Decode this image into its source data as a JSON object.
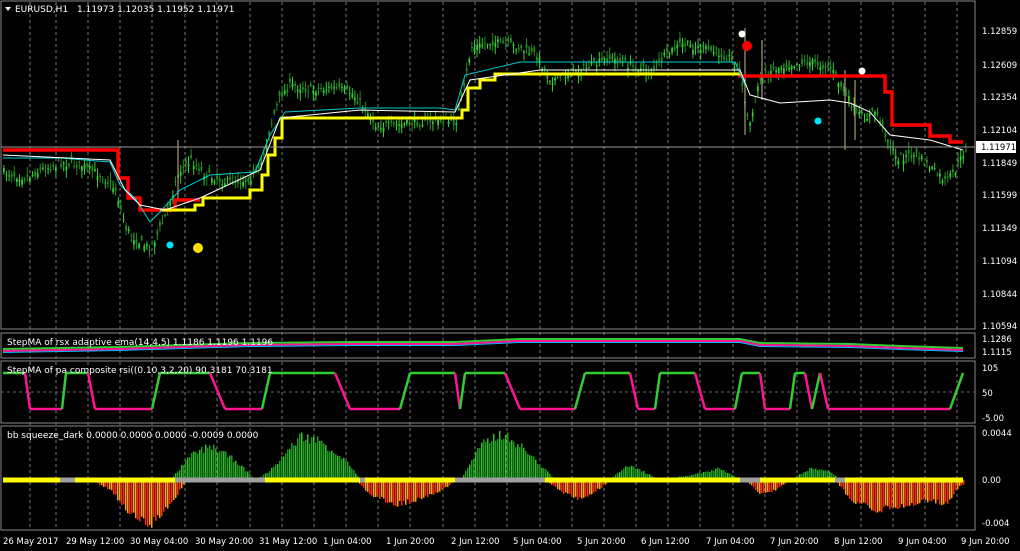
{
  "main_panel": {
    "symbol": "EURUSD,H1",
    "ohlc": "1.11973 1.12035 1.11952 1.11971",
    "price_labels": [
      "1.12859",
      "1.12609",
      "1.12354",
      "1.12104",
      "1.11849",
      "1.11599",
      "1.11349",
      "1.11094",
      "1.10844",
      "1.10594"
    ],
    "current_price": "1.11971"
  },
  "rsx_panel": {
    "title": "StepMA of rsx adaptive ema(14,4,5) 1.1186 1.1196 1.1196",
    "labels": [
      "1.1286",
      "1.1115"
    ]
  },
  "rsi_panel": {
    "title": "StepMA of pa composite rsi((0.10,3,2,20) 90.3181 70.3181",
    "labels": [
      "105",
      "50",
      "-5.00"
    ]
  },
  "squeeze_panel": {
    "title": "bb squeeze_dark 0.0000 0.0000 0.0000 -0.0009 0.0000",
    "labels": [
      "0.0044",
      "0.00",
      "-0.004"
    ]
  },
  "time_axis": [
    "26 May 2017",
    "29 May 12:00",
    "30 May 04:00",
    "30 May 20:00",
    "31 May 12:00",
    "1 Jun 04:00",
    "1 Jun 20:00",
    "2 Jun 12:00",
    "5 Jun 04:00",
    "5 Jun 20:00",
    "6 Jun 12:00",
    "7 Jun 04:00",
    "7 Jun 20:00",
    "8 Jun 12:00",
    "9 Jun 04:00",
    "9 Jun 20:00"
  ],
  "colors": {
    "bull": "#32CD32",
    "bear": "#228B22",
    "stepma_red": "#FF0000",
    "stepma_yellow": "#FFFF00",
    "cyan_line": "#00CED1",
    "white_line": "#FFFFFF",
    "magenta": "#FF1493",
    "green": "#32CD32",
    "hist_green": "#2FBF2F",
    "hist_red": "#FF2A00",
    "hist_orange": "#FFA500",
    "squeeze_yellow": "#FFFF00",
    "squeeze_gray": "#A0A0A0"
  }
}
